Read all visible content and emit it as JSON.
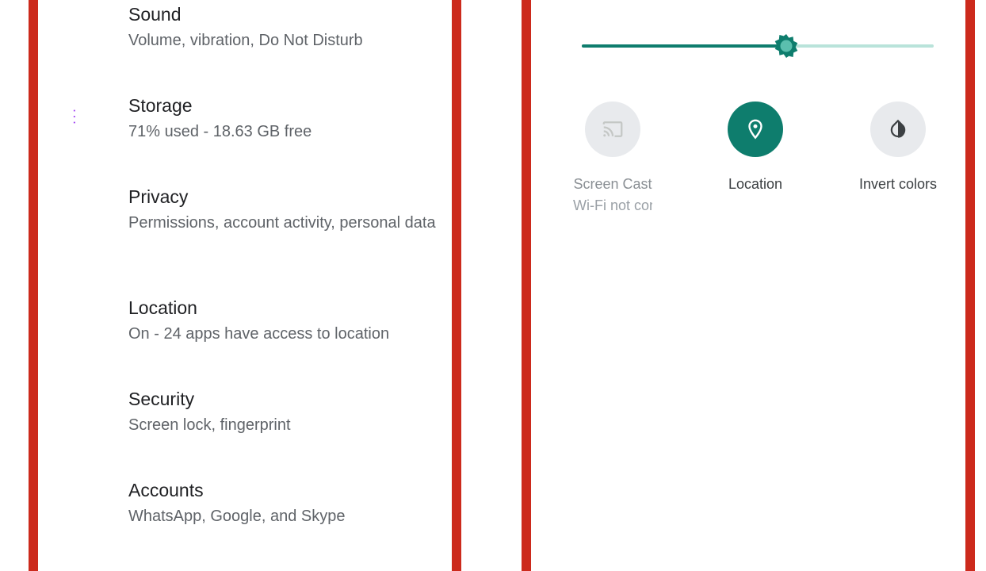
{
  "settings": {
    "items": [
      {
        "title": "Sound",
        "subtitle": "Volume, vibration, Do Not Disturb",
        "icon": "volume-icon",
        "color": "#0e9b8a"
      },
      {
        "title": "Storage",
        "subtitle": "71% used - 18.63 GB free",
        "icon": "storage-icon",
        "color": "#a142f4"
      },
      {
        "title": "Privacy",
        "subtitle": "Permissions, account activity, personal data",
        "icon": "privacy-eye-icon",
        "color": "#5b8def"
      },
      {
        "title": "Location",
        "subtitle": "On - 24 apps have access to location",
        "icon": "location-pin-icon",
        "color": "#24c1e0"
      },
      {
        "title": "Security",
        "subtitle": "Screen lock, fingerprint",
        "icon": "unlocked-padlock-icon",
        "color": "#1e8e3e"
      },
      {
        "title": "Accounts",
        "subtitle": "WhatsApp, Google, and Skype",
        "icon": "account-box-icon",
        "color": "#e8548c"
      }
    ]
  },
  "quick_settings": {
    "brightness": {
      "level": 0.58,
      "accent": "#0e7d6d",
      "track": "#b9e3da"
    },
    "tiles": [
      {
        "label": "Screen Cast",
        "sublabel": "Wi-Fi not connected",
        "state": "disabled",
        "icon": "cast-icon"
      },
      {
        "label": "Location",
        "sublabel": "",
        "state": "on",
        "icon": "location-pin-icon"
      },
      {
        "label": "Invert colors",
        "sublabel": "",
        "state": "off",
        "icon": "invert-colors-icon"
      }
    ]
  }
}
